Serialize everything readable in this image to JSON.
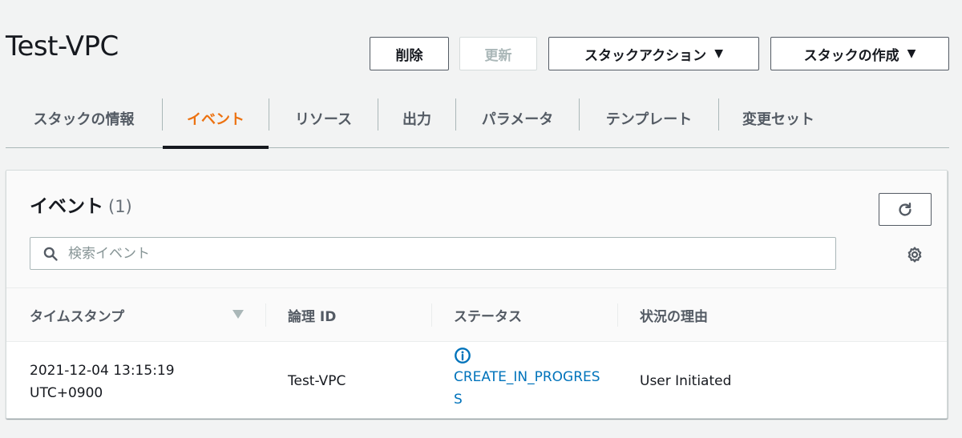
{
  "header": {
    "title": "Test-VPC",
    "buttons": {
      "delete": "削除",
      "update": "更新",
      "stack_actions": "スタックアクション",
      "create_stack": "スタックの作成"
    }
  },
  "tabs": [
    {
      "label": "スタックの情報"
    },
    {
      "label": "イベント"
    },
    {
      "label": "リソース"
    },
    {
      "label": "出力"
    },
    {
      "label": "パラメータ"
    },
    {
      "label": "テンプレート"
    },
    {
      "label": "変更セット"
    }
  ],
  "events_panel": {
    "title": "イベント",
    "count": "(1)",
    "search": {
      "placeholder": "検索イベント",
      "value": ""
    },
    "columns": [
      "タイムスタンプ",
      "論理 ID",
      "ステータス",
      "状況の理由"
    ],
    "rows": [
      {
        "timestamp_line1": "2021-12-04 13:15:19",
        "timestamp_line2": "UTC+0900",
        "logical_id": "Test-VPC",
        "status": "CREATE_IN_PROGRESS",
        "reason": "User Initiated"
      }
    ]
  },
  "colors": {
    "accent_active_tab": "#ec7211",
    "status_link": "#0073bb",
    "background": "#f2f3f3"
  },
  "icons": {
    "dropdown": "caret-down-icon",
    "refresh": "refresh-icon",
    "search": "search-icon",
    "settings": "gear-icon",
    "sort": "sort-desc-icon",
    "status": "info-icon"
  }
}
